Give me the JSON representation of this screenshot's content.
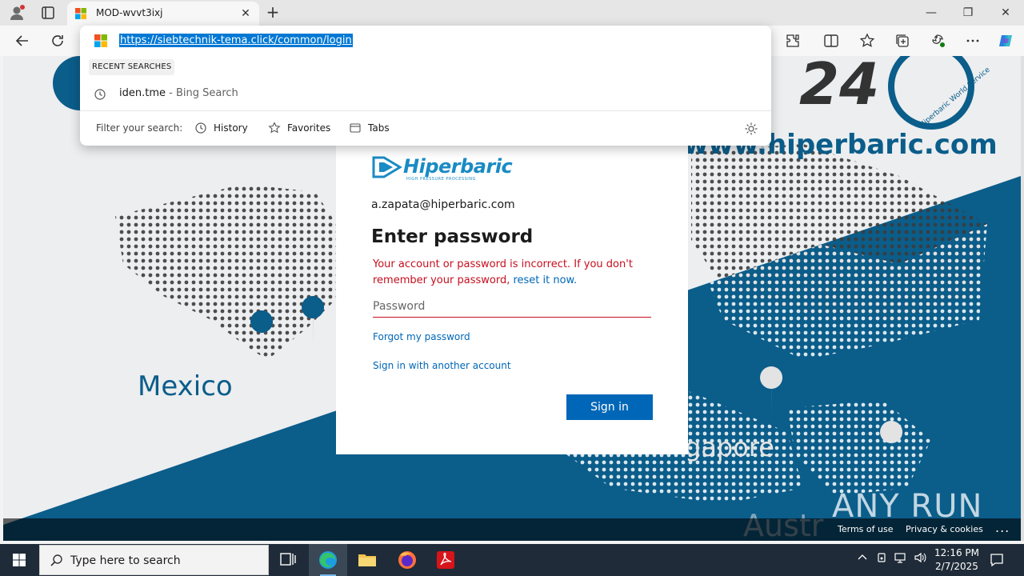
{
  "browser": {
    "tab_title": "MOD-wvvt3ixj",
    "url": "https://siebtechnik-tema.click/common/login"
  },
  "omnibox": {
    "recent_header": "RECENT SEARCHES",
    "suggestion_query": "iden.tme",
    "suggestion_source": " - Bing Search",
    "filter_label": "Filter your search:",
    "filters": [
      "History",
      "Favorites",
      "Tabs"
    ]
  },
  "login": {
    "brand": "Hiperbaric",
    "brand_tagline": "HIGH PRESSURE PROCESSING",
    "identity": "a.zapata@hiperbaric.com",
    "heading": "Enter password",
    "error_text": "Your account or password is incorrect. If you don't remember your password, ",
    "error_link": "reset it now.",
    "password_placeholder": "Password",
    "forgot_link": "Forgot my password",
    "other_account_link": "Sign in with another account",
    "signin_button": "Sign in"
  },
  "background": {
    "website": "www.hiperbaric.com",
    "badge_number": "24",
    "badge_ring_text": "Hiperbaric World Service",
    "labels": [
      "Mexico",
      "gapore",
      "Austr"
    ]
  },
  "footer": {
    "terms": "Terms of use",
    "privacy": "Privacy & cookies",
    "more": "..."
  },
  "watermark": "ANY RUN",
  "taskbar": {
    "search_placeholder": "Type here to search",
    "time": "12:16 PM",
    "date": "2/7/2025"
  },
  "colors": {
    "accent": "#0067b8",
    "error": "#c50f1f",
    "map_blue": "#0b5d8a",
    "brand": "#1a8bc4"
  }
}
